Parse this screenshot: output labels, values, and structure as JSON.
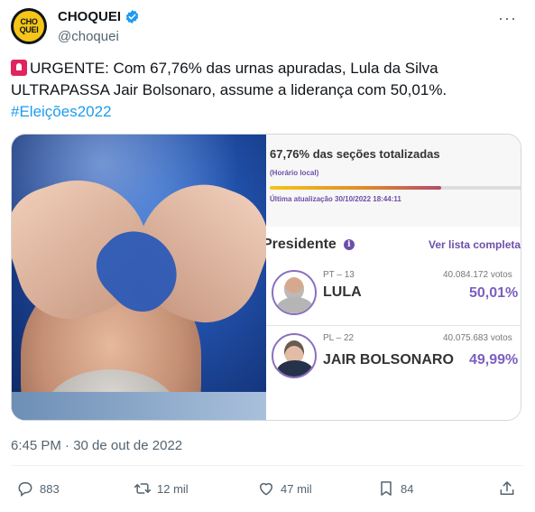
{
  "author": {
    "display_name": "CHOQUEI",
    "handle": "@choquei",
    "avatar_text": "CHO\nQUEI",
    "verified": true
  },
  "tweet": {
    "text_main": "URGENTE: Com 67,76% das urnas apuradas, Lula da Silva ULTRAPASSA Jair Bolsonaro, assume a liderança com 50,01%.",
    "hashtag": "#Eleições2022",
    "timestamp": "6:45 PM · 30 de out de 2022"
  },
  "media": {
    "panel": {
      "secoes": "67,76% das seções totalizadas",
      "horario": "(Horário local)",
      "progress": 0.6776,
      "atualizacao": "Última atualização 30/10/2022 18:44:11",
      "presidente_label": "Presidente",
      "info_icon": "i",
      "ver_lista": "Ver lista completa",
      "candidates": [
        {
          "party": "PT – 13",
          "name": "LULA",
          "votes": "40.084.172 votos",
          "pct": "50,01%"
        },
        {
          "party": "PL – 22",
          "name": "JAIR BOLSONARO",
          "votes": "40.075.683 votos",
          "pct": "49,99%"
        }
      ]
    }
  },
  "actions": {
    "reply": {
      "icon": "comment-icon",
      "count": "883"
    },
    "retweet": {
      "icon": "retweet-icon",
      "count": "12 mil"
    },
    "like": {
      "icon": "heart-icon",
      "count": "47 mil"
    },
    "bookmark": {
      "icon": "bookmark-icon",
      "count": "84"
    },
    "share": {
      "icon": "share-icon"
    }
  },
  "colors": {
    "link": "#1d9bf0",
    "muted": "#536471",
    "accent_purple": "#6d4fa8",
    "avatar_yellow": "#f5c518"
  }
}
